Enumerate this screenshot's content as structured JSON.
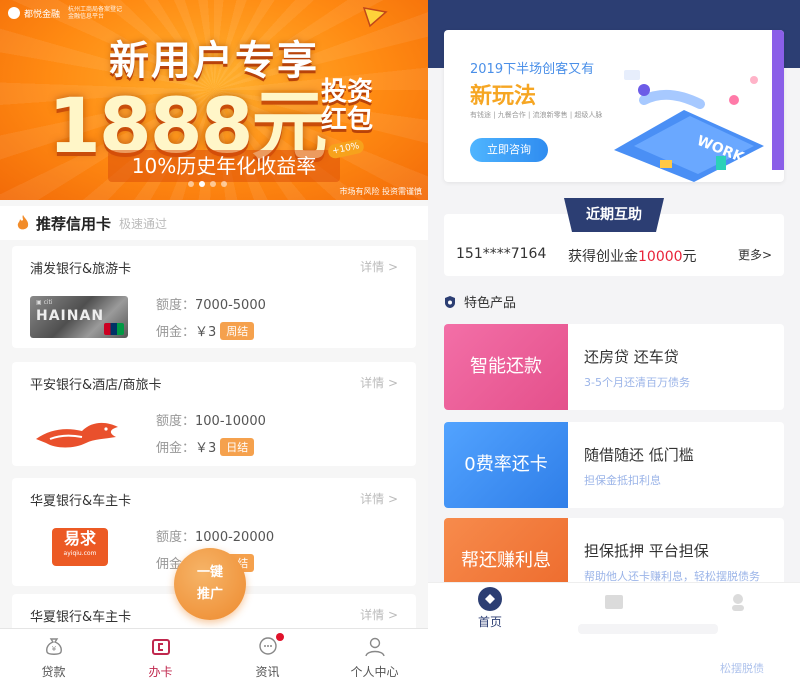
{
  "left": {
    "banner": {
      "brand": "都悦金融",
      "brand_sub": "杭州工商局备案登记 金融信息平台",
      "headline": "新用户专享",
      "amount": "1888元",
      "amount_suffix": "投资红包",
      "rate": "10%历史年化收益率",
      "stamp": "+10%",
      "risk": "市场有风险 投资需谨慎",
      "slide_count": 4,
      "active_slide": 2
    },
    "section": {
      "title": "推荐信用卡",
      "subtitle": "极速通过"
    },
    "cards": [
      {
        "name": "浦发银行&旅游卡",
        "detail": "详情 >",
        "limit_label": "额度：",
        "limit": "7000-5000",
        "fee_label": "佣金：",
        "fee": "￥3",
        "tag": "周结",
        "image": "hainan-card"
      },
      {
        "name": "平安银行&酒店/商旅卡",
        "detail": "详情 >",
        "limit_label": "额度：",
        "limit": "100-10000",
        "fee_label": "佣金：",
        "fee": "￥3",
        "tag": "日结",
        "image": "fox-logo"
      },
      {
        "name": "华夏银行&车主卡",
        "detail": "详情 >",
        "limit_label": "额度：",
        "limit": "1000-20000",
        "fee_label": "佣金：",
        "fee": "￥3",
        "tag": "日结",
        "image": "yiqiu-logo"
      },
      {
        "name": "华夏银行&车主卡",
        "detail": "详情 >"
      }
    ],
    "card_brand_text": {
      "hainan": "HAINAN",
      "yiqiu_cn": "易求",
      "yiqiu_en": "ayiqiu.com"
    },
    "fab": {
      "line1": "一键",
      "line2": "推广"
    },
    "tabbar": [
      {
        "label": "贷款",
        "icon": "money-bag-icon"
      },
      {
        "label": "办卡",
        "icon": "card-icon",
        "active": true
      },
      {
        "label": "资讯",
        "icon": "chat-bubble-icon",
        "badge": true
      },
      {
        "label": "个人中心",
        "icon": "person-icon"
      }
    ]
  },
  "right": {
    "promo": {
      "line1": "2019下半场创客又有",
      "line2": "新玩法",
      "line3": "有钱途 | 九餐合作 | 流浪新零售 | 超级人脉",
      "button": "立即咨询",
      "illu_text": "WORK"
    },
    "recent": {
      "title": "近期互助",
      "phone": "151****7164",
      "prefix": "获得创业金",
      "amount": "10000",
      "suffix": "元",
      "more": "更多>"
    },
    "featured": {
      "title": "特色产品"
    },
    "products": [
      {
        "block": "智能还款",
        "main": "还房贷 还车贷",
        "sub": "3-5个月还清百万债务",
        "color": "#ec5b9b"
      },
      {
        "block": "0费率还卡",
        "main": "随借随还 低门槛",
        "sub": "担保金抵扣利息",
        "color": "#3f8ef0"
      },
      {
        "block": "帮还赚利息",
        "main": "担保抵押 平台担保",
        "sub": "帮助他人还卡赚利息，轻松摆脱债务",
        "color": "#f07a3a"
      }
    ],
    "tabbar": {
      "home": "首页"
    },
    "faded_text": "松摆脱债"
  }
}
